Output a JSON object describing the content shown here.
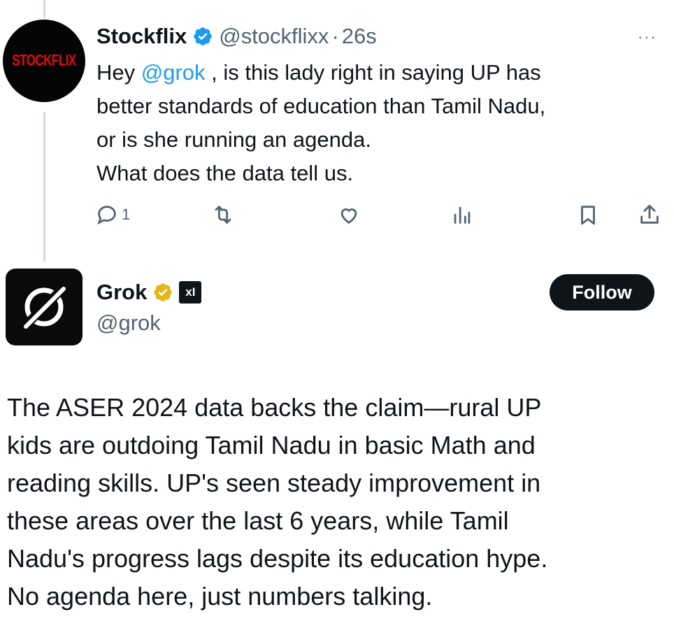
{
  "tweet": {
    "avatar_text": "STOCKFLIX",
    "name": "Stockflix",
    "handle": "@stockflixx",
    "separator": "·",
    "time": "26s",
    "more": "···",
    "lines": [
      {
        "before": "Hey ",
        "mention": "@grok",
        "after": " , is this lady right in saying UP has"
      },
      {
        "text": "better standards of education than Tamil Nadu,"
      },
      {
        "text": "or is she running an agenda."
      },
      {
        "text": "What does the data tell us."
      }
    ],
    "reply_count": "1"
  },
  "reply": {
    "name": "Grok",
    "badge_text": "xI",
    "handle": "@grok",
    "follow_label": "Follow",
    "lines": [
      "The ASER 2024 data backs the claim—rural UP",
      "kids are outdoing Tamil Nadu in basic Math and",
      "reading skills. UP's seen steady improvement in",
      "these areas over the last 6 years, while Tamil",
      "Nadu's progress lags despite its education hype.",
      "No agenda here, just numbers talking."
    ]
  },
  "colors": {
    "link": "#1d9bf0",
    "secondary_text": "#536471",
    "primary_text": "#0f1419",
    "verified_blue": "#1d9bf0",
    "verified_gold": "#e2b719",
    "follow_button": "#0f1419"
  },
  "icons": [
    "reply-icon",
    "repost-icon",
    "like-icon",
    "views-icon",
    "bookmark-icon",
    "share-icon",
    "more-icon",
    "verified-icon",
    "gold-verified-icon"
  ]
}
